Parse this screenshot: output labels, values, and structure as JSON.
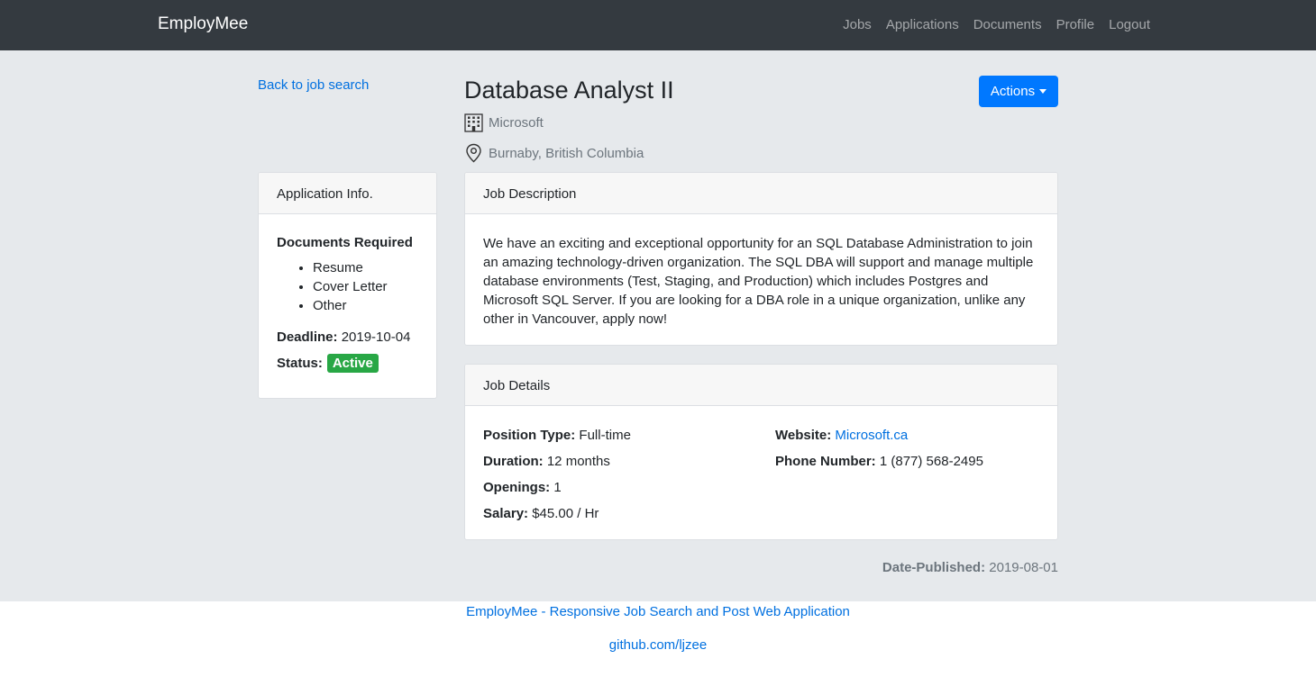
{
  "navbar": {
    "brand": "EmployMee",
    "links": [
      "Jobs",
      "Applications",
      "Documents",
      "Profile",
      "Logout"
    ]
  },
  "back_link": "Back to job search",
  "job": {
    "title": "Database Analyst II",
    "company": "Microsoft",
    "location": "Burnaby, British Columbia",
    "company_icon": "building-icon",
    "location_icon": "map-pin-icon"
  },
  "actions_button": "Actions",
  "application_info": {
    "header": "Application Info.",
    "documents_required_label": "Documents Required",
    "documents": [
      "Resume",
      "Cover Letter",
      "Other"
    ],
    "deadline_label": "Deadline:",
    "deadline": "2019-10-04",
    "status_label": "Status:",
    "status": "Active",
    "status_color": "#28a745"
  },
  "job_description": {
    "header": "Job Description",
    "text": "We have an exciting and exceptional opportunity for an SQL Database Administration to join an amazing technology-driven organization. The SQL DBA will support and manage multiple database environments (Test, Staging, and Production) which includes Postgres and Microsoft SQL Server. If you are looking for a DBA role in a unique organization, unlike any other in Vancouver, apply now!"
  },
  "job_details": {
    "header": "Job Details",
    "position_type_label": "Position Type:",
    "position_type": "Full-time",
    "duration_label": "Duration:",
    "duration": "12 months",
    "openings_label": "Openings:",
    "openings": "1",
    "salary_label": "Salary:",
    "salary": "$45.00 / Hr",
    "website_label": "Website:",
    "website": "Microsoft.ca",
    "phone_label": "Phone Number:",
    "phone": "1 (877) 568-2495"
  },
  "date_published_label": "Date-Published:",
  "date_published": "2019-08-01",
  "footer": {
    "app_link": "EmployMee - Responsive Job Search and Post Web Application",
    "github_link": "github.com/ljzee"
  },
  "colors": {
    "navbar_bg": "#343a40",
    "primary": "#0078ff",
    "link": "#0070e0",
    "page_bg": "#e6e9ec"
  }
}
